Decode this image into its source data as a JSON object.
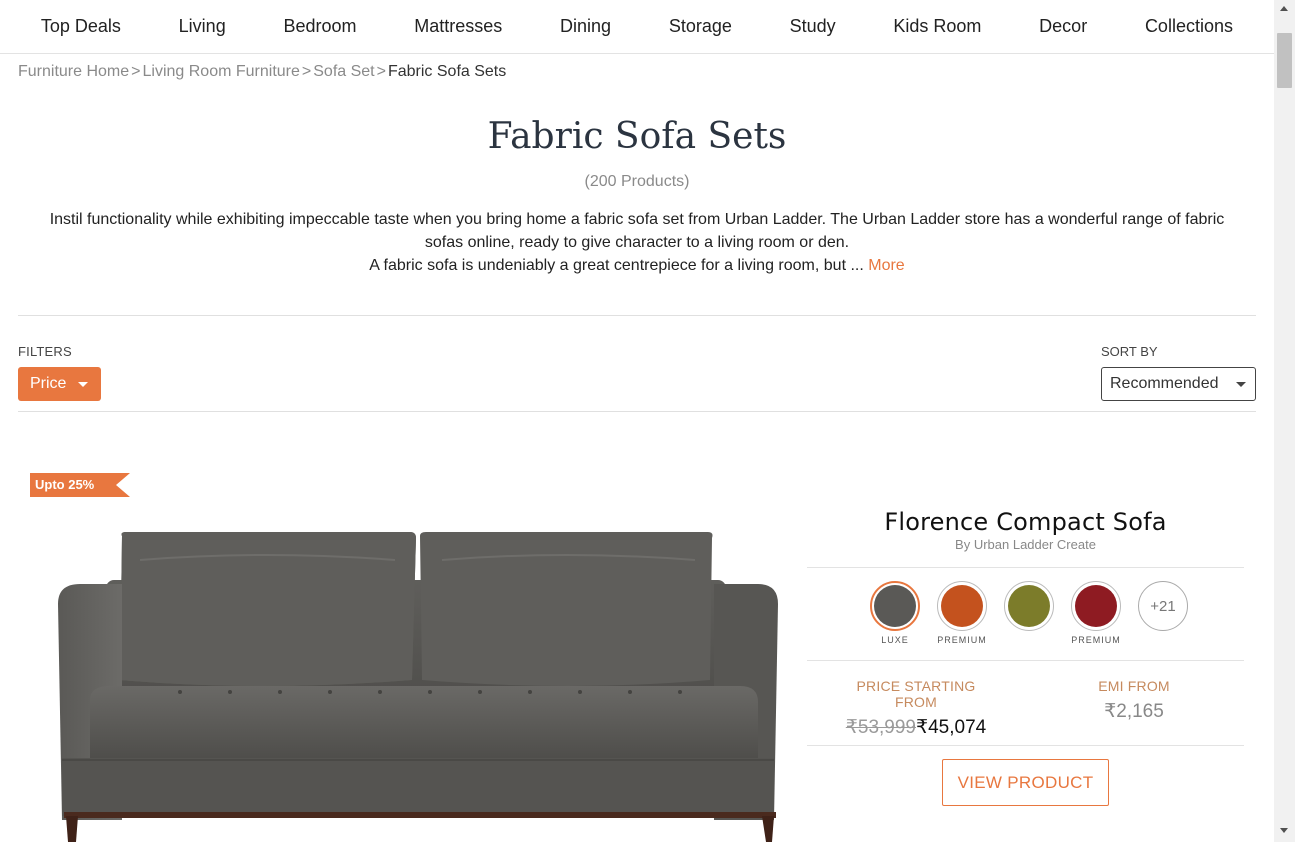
{
  "nav": {
    "items": [
      "Top Deals",
      "Living",
      "Bedroom",
      "Mattresses",
      "Dining",
      "Storage",
      "Study",
      "Kids Room",
      "Decor",
      "Collections"
    ]
  },
  "breadcrumb": {
    "items": [
      "Furniture Home",
      "Living Room Furniture",
      "Sofa Set"
    ],
    "separator": ">",
    "current": "Fabric Sofa Sets"
  },
  "header": {
    "title": "Fabric Sofa Sets",
    "count": "(200 Products)",
    "description_line1": "Instil functionality while exhibiting impeccable taste when you bring home a fabric sofa set from Urban Ladder. The Urban Ladder store has a wonderful range of fabric sofas online, ready to give character to a living room or den.",
    "description_line2": "A fabric sofa is undeniably a great centrepiece for a living room, but ...",
    "more_label": "More"
  },
  "filters": {
    "label": "FILTERS",
    "price_label": "Price"
  },
  "sort": {
    "label": "SORT BY",
    "selected": "Recommended"
  },
  "product": {
    "discount": "Upto 25%",
    "name": "Florence Compact Sofa",
    "brand": "By Urban Ladder Create",
    "swatches": [
      {
        "color": "#5a5956",
        "tag": "LUXE",
        "icon": "swatch-grey"
      },
      {
        "color": "#c4521e",
        "tag": "PREMIUM",
        "icon": "swatch-orange"
      },
      {
        "color": "#7c7c2a",
        "tag": "",
        "icon": "swatch-olive"
      },
      {
        "color": "#8e1b22",
        "tag": "PREMIUM",
        "icon": "swatch-maroon"
      }
    ],
    "more_swatches": "+21",
    "price_label": "PRICE STARTING FROM",
    "old_price": "₹53,999",
    "new_price": "₹45,074",
    "emi_label": "EMI FROM",
    "emi_value": "₹2,165",
    "view_button": "VIEW PRODUCT"
  },
  "colors": {
    "accent": "#e8773f",
    "sofa": "#5b5a57",
    "legs": "#4a2a1e"
  }
}
